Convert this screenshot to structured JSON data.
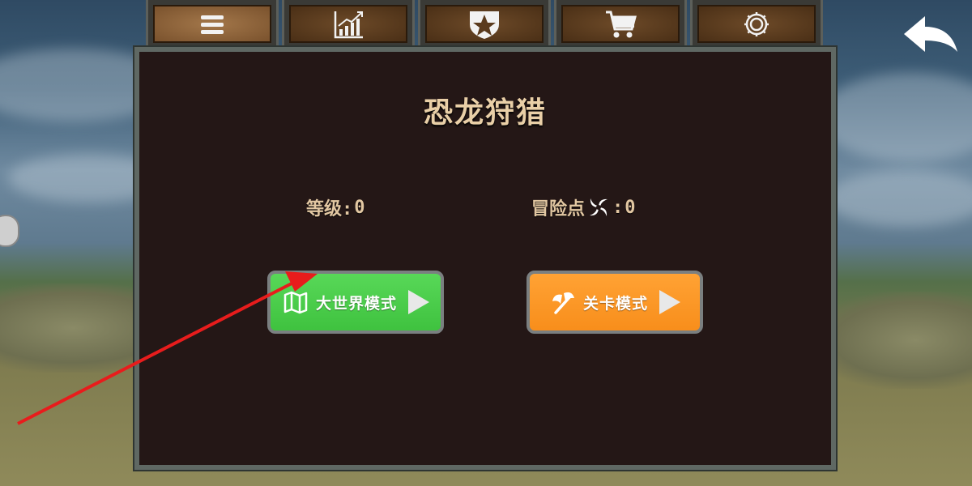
{
  "tabs": [
    {
      "icon": "menu-icon",
      "active": true
    },
    {
      "icon": "stats-chart-icon",
      "active": false
    },
    {
      "icon": "star-shield-icon",
      "active": false
    },
    {
      "icon": "shopping-cart-icon",
      "active": false
    },
    {
      "icon": "gear-icon",
      "active": false
    }
  ],
  "panel": {
    "title": "恐龙狩猎",
    "level_label": "等级:",
    "level_value": "0",
    "adventure_label": "冒险点",
    "adventure_value": "0",
    "adventure_sep": ":"
  },
  "buttons": {
    "world_mode": "大世界模式",
    "stage_mode": "关卡模式"
  },
  "colors": {
    "world_button": "#4ccc4c",
    "stage_button": "#f8961f",
    "annotation_arrow": "#e81c1c"
  }
}
